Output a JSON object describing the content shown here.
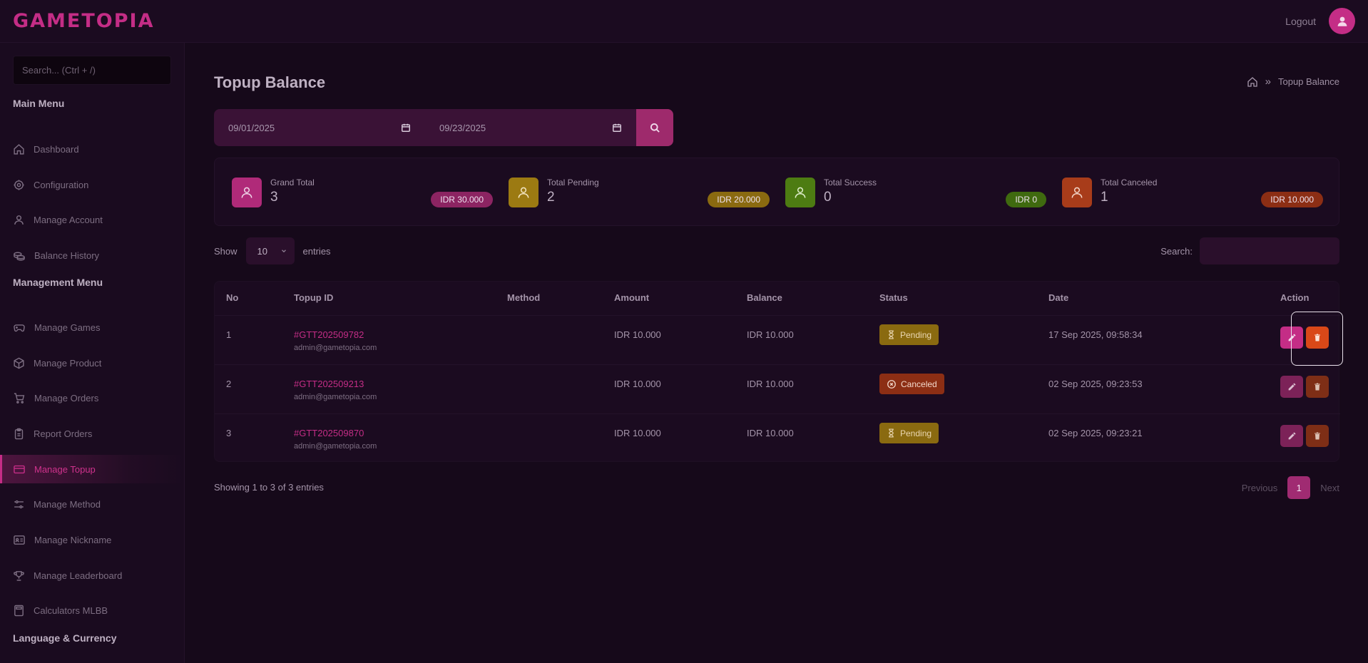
{
  "header": {
    "logo": "GAMETOPIA",
    "logout_label": "Logout"
  },
  "sidebar": {
    "search_placeholder": "Search... (Ctrl + /)",
    "sections": {
      "main": "Main Menu",
      "management": "Management Menu",
      "language": "Language & Currency"
    },
    "main_items": [
      {
        "label": "Dashboard",
        "icon": "home-icon"
      },
      {
        "label": "Configuration",
        "icon": "gear-icon"
      },
      {
        "label": "Manage Account",
        "icon": "user-icon"
      },
      {
        "label": "Balance History",
        "icon": "coins-icon"
      }
    ],
    "management_items": [
      {
        "label": "Manage Games",
        "icon": "gamepad-icon"
      },
      {
        "label": "Manage Product",
        "icon": "box-icon"
      },
      {
        "label": "Manage Orders",
        "icon": "cart-icon"
      },
      {
        "label": "Report Orders",
        "icon": "clipboard-icon"
      },
      {
        "label": "Manage Topup",
        "icon": "wallet-icon",
        "active": true
      },
      {
        "label": "Manage Method",
        "icon": "sliders-icon"
      },
      {
        "label": "Manage Nickname",
        "icon": "id-card-icon"
      },
      {
        "label": "Manage Leaderboard",
        "icon": "trophy-icon"
      },
      {
        "label": "Calculators MLBB",
        "icon": "calculator-icon"
      }
    ]
  },
  "page": {
    "title": "Topup Balance",
    "breadcrumb_current": "Topup Balance"
  },
  "filter": {
    "date_from": "09/01/2025",
    "date_to": "09/23/2025"
  },
  "stats": [
    {
      "label": "Grand Total",
      "value": "3",
      "badge": "IDR 30.000",
      "color": "#b02a79"
    },
    {
      "label": "Total Pending",
      "value": "2",
      "badge": "IDR 20.000",
      "color": "#9c7a12"
    },
    {
      "label": "Total Success",
      "value": "0",
      "badge": "IDR 0",
      "color": "#4d7c12"
    },
    {
      "label": "Total Canceled",
      "value": "1",
      "badge": "IDR 10.000",
      "color": "#a83c1a"
    }
  ],
  "table_controls": {
    "show_label": "Show",
    "entries_value": "10",
    "entries_label": "entries",
    "search_label": "Search:"
  },
  "table": {
    "columns": [
      "No",
      "Topup ID",
      "Method",
      "Amount",
      "Balance",
      "Status",
      "Date",
      "Action"
    ],
    "rows": [
      {
        "no": "1",
        "topup_id": "#GTT202509782",
        "email": "admin@gametopia.com",
        "method": "",
        "amount": "IDR 10.000",
        "balance": "IDR 10.000",
        "status": "Pending",
        "date": "17 Sep 2025, 09:58:34"
      },
      {
        "no": "2",
        "topup_id": "#GTT202509213",
        "email": "admin@gametopia.com",
        "method": "",
        "amount": "IDR 10.000",
        "balance": "IDR 10.000",
        "status": "Canceled",
        "date": "02 Sep 2025, 09:23:53"
      },
      {
        "no": "3",
        "topup_id": "#GTT202509870",
        "email": "admin@gametopia.com",
        "method": "",
        "amount": "IDR 10.000",
        "balance": "IDR 10.000",
        "status": "Pending",
        "date": "02 Sep 2025, 09:23:21"
      }
    ]
  },
  "footer": {
    "info": "Showing 1 to 3 of 3 entries",
    "previous": "Previous",
    "page": "1",
    "next": "Next"
  },
  "colors": {
    "accent": "#c42d86",
    "pending": "#8a6a10",
    "canceled": "#8c2e14"
  }
}
